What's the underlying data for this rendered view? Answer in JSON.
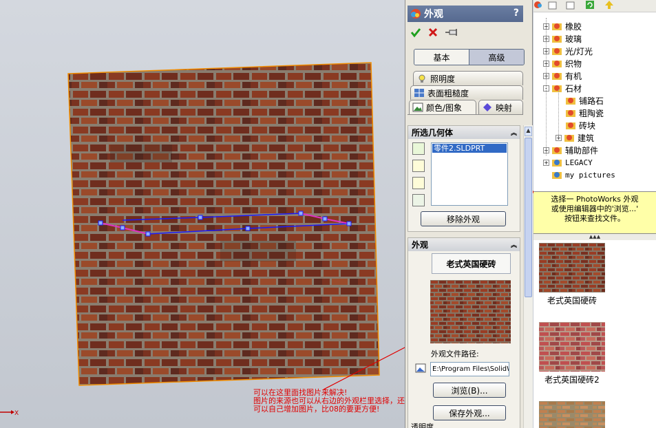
{
  "viewport": {
    "axis_label": "X",
    "annotation": "可以在这里面找图片来解决!\n图片的来源也可以从右边的外观栏里选择，还\n可以自己增加图片，比08的要更方便!"
  },
  "property_manager": {
    "title": "外观",
    "help": "?",
    "mode_tabs": {
      "basic": "基本",
      "advanced": "高级"
    },
    "tabs": [
      "照明度",
      "表面粗糙度",
      "颜色/图象",
      "映射"
    ],
    "selected_geometry": {
      "header": "所选几何体",
      "items": [
        "零件2.SLDPRT"
      ],
      "remove_button": "移除外观"
    },
    "appearance": {
      "header": "外观",
      "name": "老式英国硬砖",
      "path_label": "外观文件路径:",
      "path_value": "E:\\Program Files\\SolidW",
      "browse_button": "浏览(B)...",
      "save_button": "保存外观..."
    },
    "bottom_label": "透明度"
  },
  "library": {
    "tree": [
      {
        "label": "橡胶",
        "expand": "+",
        "indent": 0
      },
      {
        "label": "玻璃",
        "expand": "+",
        "indent": 0
      },
      {
        "label": "光/灯光",
        "expand": "+",
        "indent": 0
      },
      {
        "label": "织物",
        "expand": "+",
        "indent": 0
      },
      {
        "label": "有机",
        "expand": "+",
        "indent": 0
      },
      {
        "label": "石材",
        "expand": "-",
        "indent": 0
      },
      {
        "label": "铺路石",
        "expand": "",
        "indent": 1
      },
      {
        "label": "粗陶瓷",
        "expand": "",
        "indent": 1
      },
      {
        "label": "砖块",
        "expand": "",
        "indent": 1
      },
      {
        "label": "建筑",
        "expand": "+",
        "indent": 1
      },
      {
        "label": "辅助部件",
        "expand": "+",
        "indent": 0
      },
      {
        "label": "LEGACY",
        "expand": "+",
        "indent": 0
      },
      {
        "label": "my pictures",
        "expand": "",
        "indent": 0
      }
    ],
    "tooltip": "选择一 PhotoWorks 外观\n或使用编辑器中的'浏览...'\n按钮来查找文件。",
    "thumbnails": [
      {
        "caption": "老式英国硬砖"
      },
      {
        "caption": "老式英国硬砖2"
      },
      {
        "caption": ""
      }
    ]
  },
  "colors": {
    "accent_orange": "#f08c00",
    "sketch_blue": "#1a1aff",
    "sketch_magenta": "#e033c0",
    "annotation_red": "#e00000",
    "selection_blue": "#316ac5",
    "tooltip_yellow": "#ffffa8"
  }
}
